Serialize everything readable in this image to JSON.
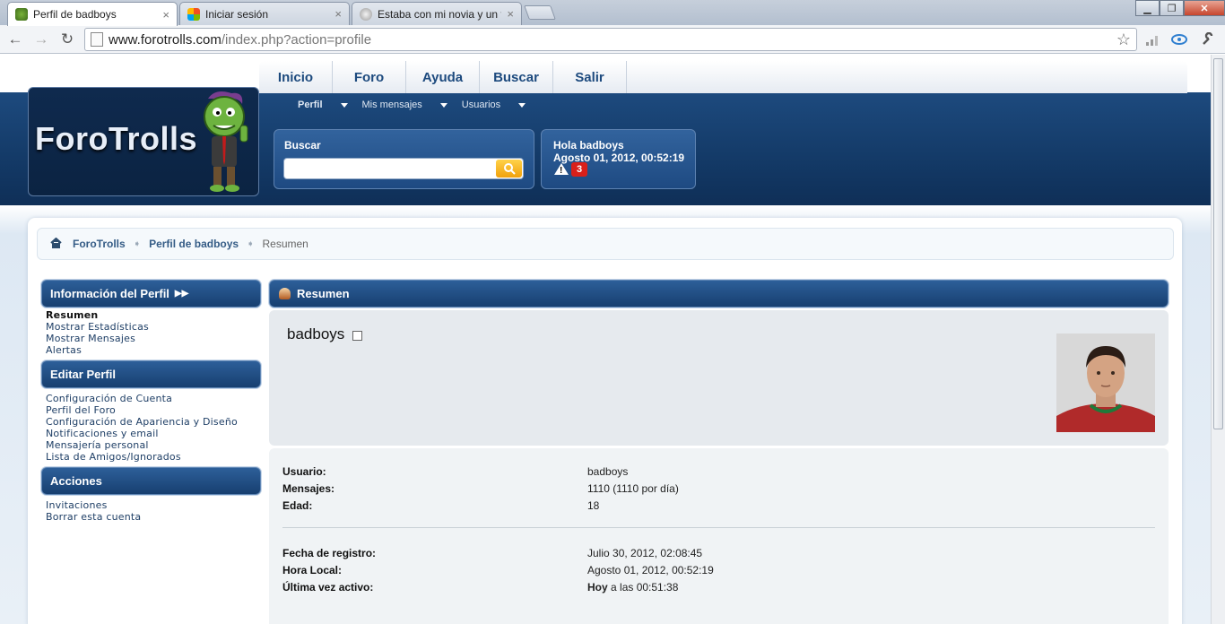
{
  "browser": {
    "tabs": [
      {
        "title": "Perfil de badboys",
        "active": true
      },
      {
        "title": "Iniciar sesión",
        "active": false
      },
      {
        "title": "Estaba con mi novia y un fl",
        "active": false
      }
    ],
    "url_host": "www.forotrolls.com",
    "url_path": "/index.php?action=profile",
    "buttons": {
      "back": "←",
      "forward": "→",
      "reload": "↻",
      "star": "☆",
      "minimize": "▁",
      "maximize": "❐",
      "close": "✕"
    }
  },
  "site": {
    "logo": {
      "part1": "Foro",
      "part2": "Trolls"
    },
    "topnav": [
      "Inicio",
      "Foro",
      "Ayuda",
      "Buscar",
      "Salir"
    ],
    "subnav": [
      "Perfil",
      "Mis mensajes",
      "Usuarios"
    ],
    "search": {
      "label": "Buscar",
      "placeholder": ""
    },
    "user": {
      "greeting": "Hola badboys",
      "datetime": "Agosto 01, 2012, 00:52:19",
      "alerts": "3"
    },
    "breadcrumb": [
      "ForoTrolls",
      "Perfil de badboys",
      "Resumen"
    ]
  },
  "sidebar": {
    "sections": [
      {
        "title": "Información del Perfil",
        "items": [
          "Resumen",
          "Mostrar Estadísticas",
          "Mostrar Mensajes",
          "Alertas"
        ]
      },
      {
        "title": "Editar Perfil",
        "items": [
          "Configuración de Cuenta",
          "Perfil del Foro",
          "Configuración de Apariencia y Diseño",
          "Notificaciones y email",
          "Mensajería personal",
          "Lista de Amigos/Ignorados"
        ]
      },
      {
        "title": "Acciones",
        "items": [
          "Invitaciones",
          "Borrar esta cuenta"
        ]
      }
    ]
  },
  "main": {
    "title": "Resumen",
    "username": "badboys",
    "fields": [
      {
        "label": "Usuario:",
        "value": "badboys"
      },
      {
        "label": "Mensajes:",
        "value": "1110 (1110 por día)"
      },
      {
        "label": "Edad:",
        "value": "18"
      }
    ],
    "fields2": [
      {
        "label": "Fecha de registro:",
        "value": "Julio 30, 2012, 02:08:45"
      },
      {
        "label": "Hora Local:",
        "value": "Agosto 01, 2012, 00:52:19"
      },
      {
        "label": "Última vez activo:",
        "value_bold": "Hoy",
        "value_rest": "a las 00:51:38"
      }
    ]
  },
  "colors": {
    "accent": "#1d4a7e",
    "header": "#123763",
    "alert": "#d9201a"
  }
}
